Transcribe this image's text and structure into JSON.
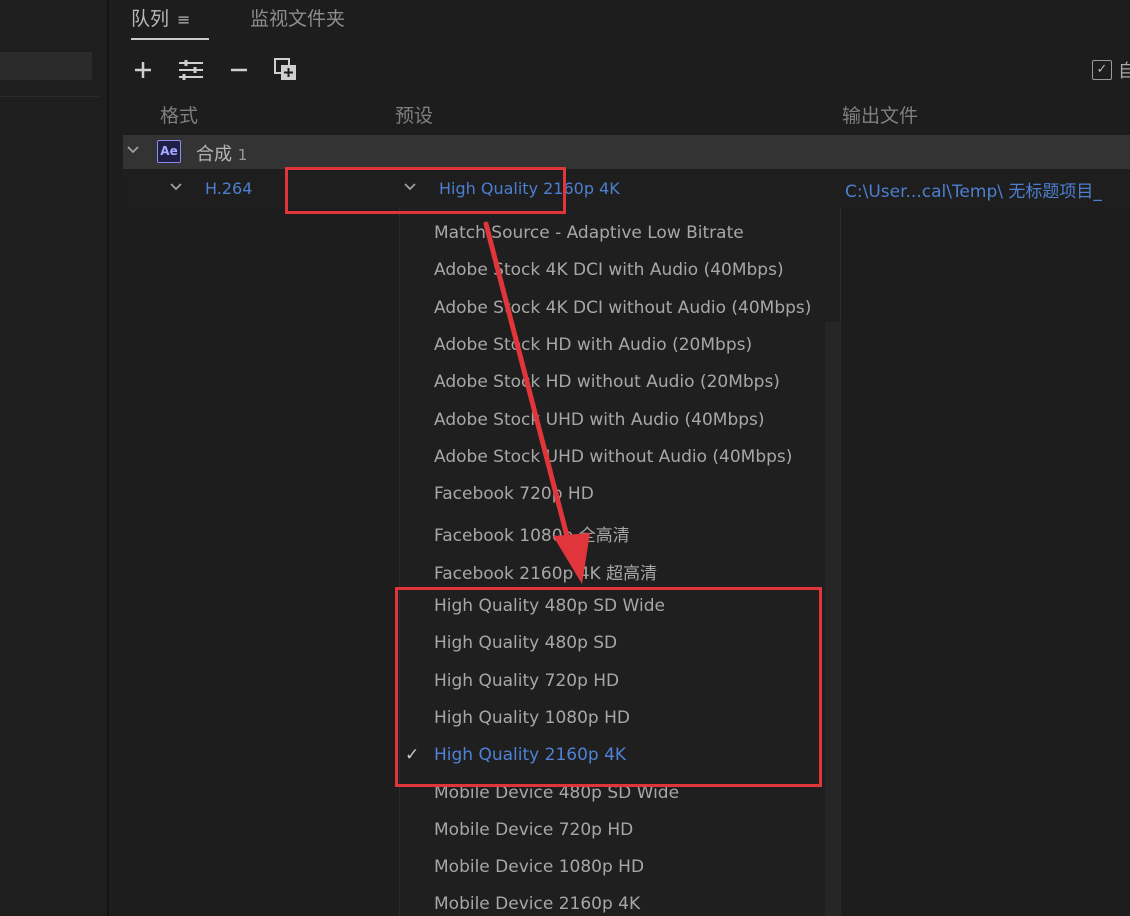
{
  "tabs": {
    "queue": "队列",
    "queue_menu": "≡",
    "watch": "监视文件夹"
  },
  "toolbar": {
    "add": "+",
    "settings": "⁝",
    "remove": "−",
    "duplicate": "⧉",
    "auto_checkbox": "✓",
    "auto_label": "自"
  },
  "columns": {
    "format": "格式",
    "preset": "预设",
    "output": "输出文件"
  },
  "composition": {
    "icon_label": "Ae",
    "name": "合成",
    "number": "1"
  },
  "item": {
    "format": "H.264",
    "preset": "High Quality 2160p 4K",
    "output": "C:\\User...cal\\Temp\\ 无标题项目_"
  },
  "dropdown": {
    "options": [
      "Match Source - Adaptive Low Bitrate",
      "Adobe Stock 4K DCI with Audio (40Mbps)",
      "Adobe Stock 4K DCI without Audio (40Mbps)",
      "Adobe Stock HD with Audio (20Mbps)",
      "Adobe Stock HD without Audio (20Mbps)",
      "Adobe Stock UHD with Audio (40Mbps)",
      "Adobe Stock UHD without Audio (40Mbps)",
      "Facebook 720p HD",
      "Facebook 1080p 全高清",
      "Facebook 2160p 4K 超高清",
      "High Quality 480p SD Wide",
      "High Quality 480p SD",
      "High Quality 720p HD",
      "High Quality 1080p HD",
      "High Quality 2160p 4K",
      "Mobile Device 480p SD Wide",
      "Mobile Device 720p HD",
      "Mobile Device 1080p HD",
      "Mobile Device 2160p 4K"
    ],
    "selected_index": 14,
    "check_mark": "✓"
  },
  "colors": {
    "highlight_red": "#e0353a",
    "link_blue": "#4f82d6",
    "ae_purple": "#8c8cf0"
  }
}
